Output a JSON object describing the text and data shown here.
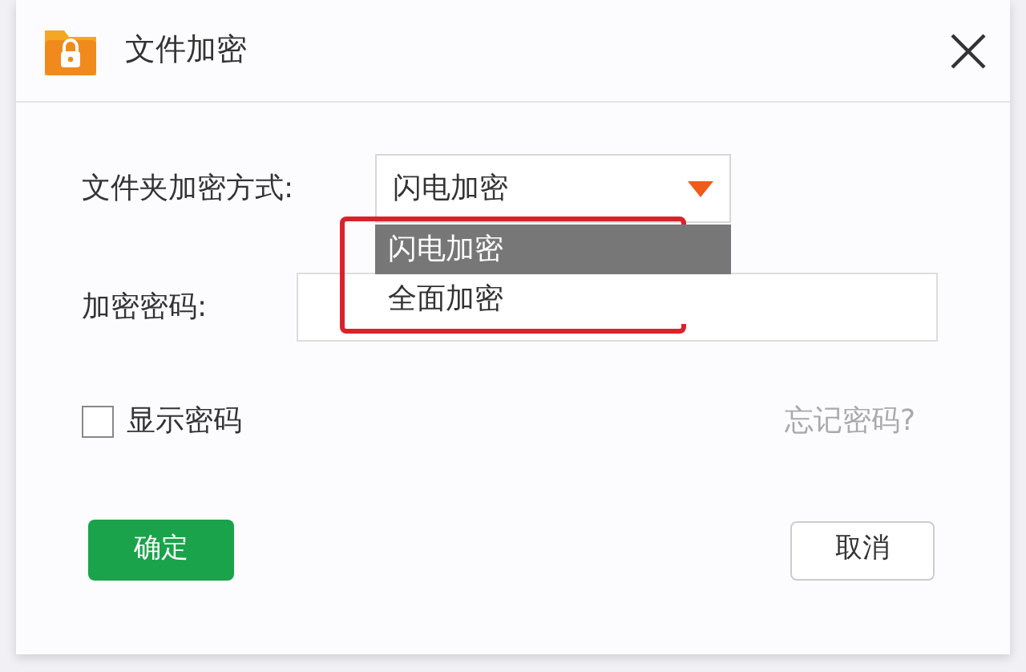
{
  "window": {
    "title": "文件加密"
  },
  "method": {
    "label": "文件夹加密方式:",
    "value": "闪电加密",
    "expanded": true,
    "highlighted": true,
    "options": [
      {
        "label": "闪电加密",
        "selected": true
      },
      {
        "label": "全面加密",
        "selected": false
      }
    ]
  },
  "password": {
    "label": "加密密码:"
  },
  "show_password": {
    "label": "显示密码",
    "checked": false
  },
  "forgot_link": "忘记密码?",
  "buttons": {
    "ok": "确定",
    "cancel": "取消"
  }
}
